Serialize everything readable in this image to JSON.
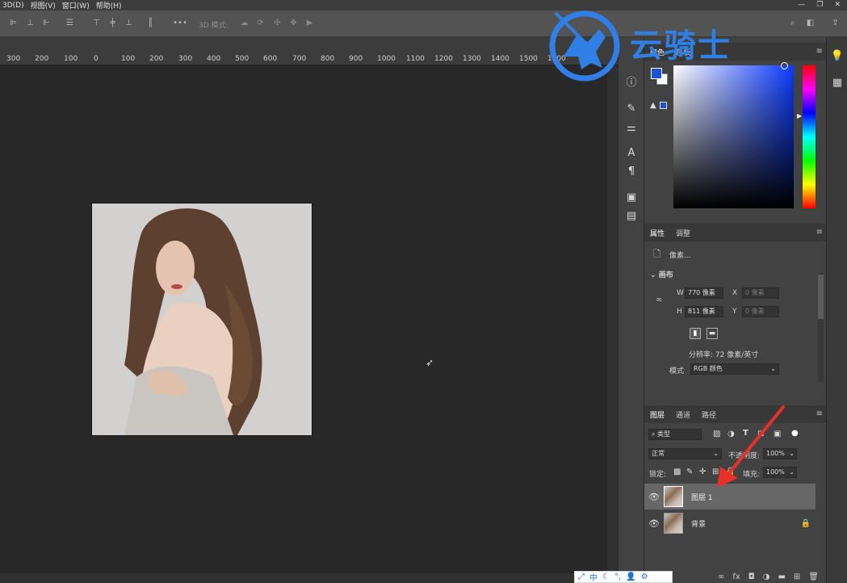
{
  "menubar": {
    "items": [
      "3D(D)",
      "视图(V)",
      "窗口(W)",
      "帮助(H)"
    ]
  },
  "optionsbar": {
    "mode_label": "3D 模式:",
    "more_label": "•••"
  },
  "ruler": {
    "ticks": [
      "300",
      "200",
      "100",
      "0",
      "100",
      "200",
      "300",
      "400",
      "500",
      "600",
      "700",
      "800",
      "900",
      "1000",
      "1100",
      "1200",
      "1300",
      "1400",
      "1500",
      "1600"
    ]
  },
  "watermark": {
    "text": "云骑士"
  },
  "color_panel": {
    "tabs": [
      "颜色",
      "色板"
    ],
    "fg": "#1c52d6",
    "bg": "#ffffff",
    "hue_color": "#0a3aff"
  },
  "properties_panel": {
    "tabs": [
      "属性",
      "调整"
    ],
    "type_label": "像素...",
    "section": "画布",
    "w_label": "W",
    "w_value": "770 像素",
    "h_label": "H",
    "h_value": "811 像素",
    "x_label": "X",
    "x_value": "0 像素",
    "y_label": "Y",
    "y_value": "0 像素",
    "resolution": "分辨率: 72 像素/英寸",
    "mode_label": "模式",
    "mode_value": "RGB 颜色"
  },
  "layers_panel": {
    "tabs": [
      "图层",
      "通道",
      "路径"
    ],
    "filter_label": "类型",
    "blend_mode": "正常",
    "opacity_label": "不透明度:",
    "opacity_value": "100%",
    "lock_label": "锁定:",
    "fill_label": "填充:",
    "fill_value": "100%",
    "layers": [
      {
        "name": "图层 1"
      },
      {
        "name": "背景"
      }
    ]
  },
  "ime": {
    "lang": "中"
  },
  "colors": {
    "annotation_arrow": "#e8302a",
    "accent": "#2f7fe6"
  }
}
